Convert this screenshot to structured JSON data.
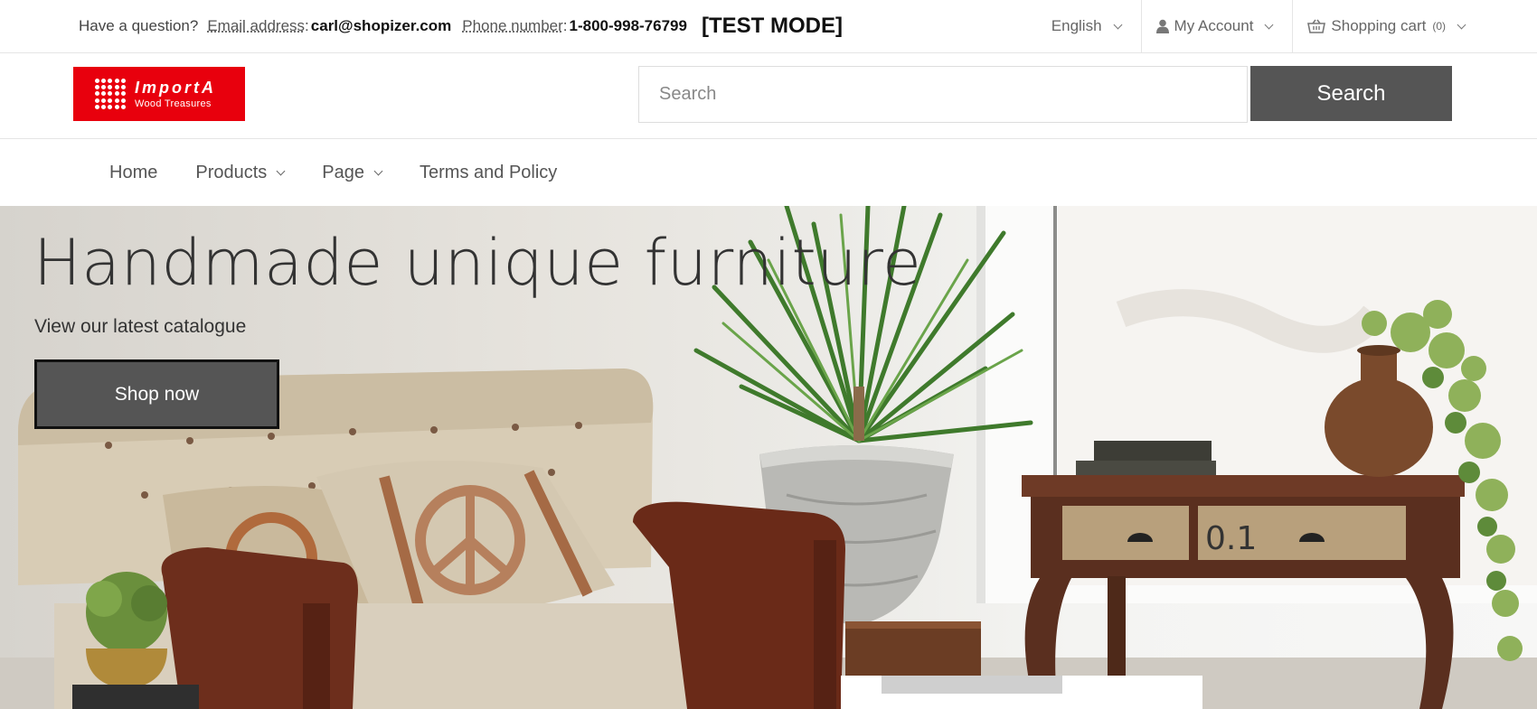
{
  "topbar": {
    "question": "Have a question?",
    "email_label": "Email address",
    "email": "carl@shopizer.com",
    "phone_label": "Phone number",
    "phone": "1-800-998-76799",
    "test_mode": "[TEST MODE]",
    "language": "English",
    "account": "My Account",
    "cart": "Shopping cart",
    "cart_count": "(0)"
  },
  "header": {
    "logo_brand": "ImportA",
    "logo_tagline": "Wood Treasures",
    "search_placeholder": "Search",
    "search_button": "Search"
  },
  "nav": {
    "items": [
      {
        "label": "Home"
      },
      {
        "label": "Products"
      },
      {
        "label": "Page"
      },
      {
        "label": "Terms and Policy"
      }
    ]
  },
  "hero": {
    "title": "Handmade unique furniture",
    "subtitle": "View our latest catalogue",
    "cta": "Shop now",
    "drawer_label": "0.1"
  },
  "colors": {
    "logo_red": "#e8000d",
    "button_gray": "#555555"
  },
  "icons": [
    "user-icon",
    "basket-icon",
    "chevron-down-icon"
  ]
}
